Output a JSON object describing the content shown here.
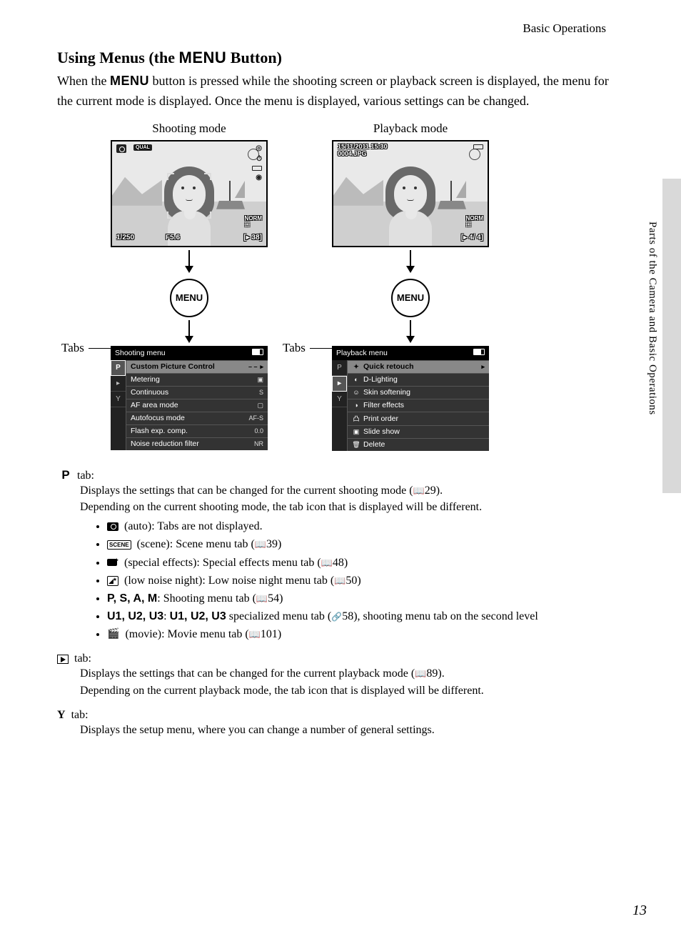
{
  "header": {
    "label": "Basic Operations"
  },
  "title": {
    "prefix": "Using Menus (the ",
    "menu": "MENU",
    "suffix": " Button)"
  },
  "intro": {
    "p1a": "When the ",
    "menu": "MENU",
    "p1b": " button is pressed while the shooting screen or playback screen is displayed, the menu for the current mode is displayed. Once the menu is displayed, various settings can be changed."
  },
  "columns": {
    "shooting": {
      "label": "Shooting mode",
      "qual": "QUAL",
      "norm": "NORM",
      "shutter": "1/250",
      "aperture": "F5.6",
      "remaining_prefix": "[",
      "remaining": "  38]",
      "menu_btn": "MENU",
      "menu_title": "Shooting menu",
      "tabs_label": "Tabs",
      "tabs": {
        "p": "P",
        "play": "▸",
        "wrench": "Y"
      },
      "items": [
        {
          "label": "Custom Picture Control",
          "value": "– –",
          "highlight": true,
          "caret": true
        },
        {
          "label": "Metering",
          "value": "▣"
        },
        {
          "label": "Continuous",
          "value": "S"
        },
        {
          "label": "AF area mode",
          "value": "▢"
        },
        {
          "label": "Autofocus mode",
          "value": "AF-S"
        },
        {
          "label": "Flash exp. comp.",
          "value": "0.0"
        },
        {
          "label": "Noise reduction filter",
          "value": "NR"
        }
      ]
    },
    "playback": {
      "label": "Playback mode",
      "date": "15/11/2011  15:30",
      "file": "0004.JPG",
      "norm": "NORM",
      "counter_prefix": "[",
      "counter": "   4/    4]",
      "menu_btn": "MENU",
      "menu_title": "Playback menu",
      "tabs_label": "Tabs",
      "tabs": {
        "p": "P",
        "play": "▸",
        "wrench": "Y"
      },
      "items": [
        {
          "icon": "✦",
          "label": "Quick retouch",
          "highlight": true,
          "caret": true
        },
        {
          "icon": "◐",
          "label": "D-Lighting"
        },
        {
          "icon": "☺",
          "label": "Skin softening"
        },
        {
          "icon": "◑",
          "label": "Filter effects"
        },
        {
          "icon": "凸",
          "label": "Print order"
        },
        {
          "icon": "▣",
          "label": "Slide show"
        },
        {
          "icon": "🗑",
          "label": "Delete"
        }
      ]
    }
  },
  "descriptions": {
    "p_tab": {
      "letter": "P",
      "word": "tab:",
      "line1a": "Displays the settings that can be changed for the current shooting mode (",
      "ref29": "29).",
      "line2": "Depending on the current shooting mode, the tab icon that is displayed will be different.",
      "b_auto": " (auto): Tabs are not displayed.",
      "b_scene_label": "SCENE",
      "b_scene": " (scene): Scene menu tab (",
      "ref39": "39)",
      "b_special": " (special effects): Special effects menu tab (",
      "ref48": "48)",
      "b_lownoise": " (low noise night): Low noise night menu tab (",
      "ref50": "50)",
      "b_psam_modes": "P, S, A, M",
      "b_psam": ": Shooting menu tab (",
      "ref54": "54)",
      "b_u_modes": "U1, U2, U3",
      "b_u_sep": ": ",
      "b_u_modes2": "U1, U2, U3",
      "b_u_text1": " specialized menu tab (",
      "ref58": "58), shooting menu tab on the second level",
      "b_movie": " (movie): Movie menu tab (",
      "ref101": "101)"
    },
    "play_tab": {
      "word": "tab:",
      "line1a": "Displays the settings that can be changed for the current playback mode (",
      "ref89": "89).",
      "line2": "Depending on the current playback mode, the tab icon that is displayed will be different."
    },
    "setup_tab": {
      "word": "tab:",
      "line1": "Displays the setup menu, where you can change a number of general settings."
    }
  },
  "side": {
    "text": "Parts of the Camera and Basic Operations"
  },
  "page_number": "13"
}
